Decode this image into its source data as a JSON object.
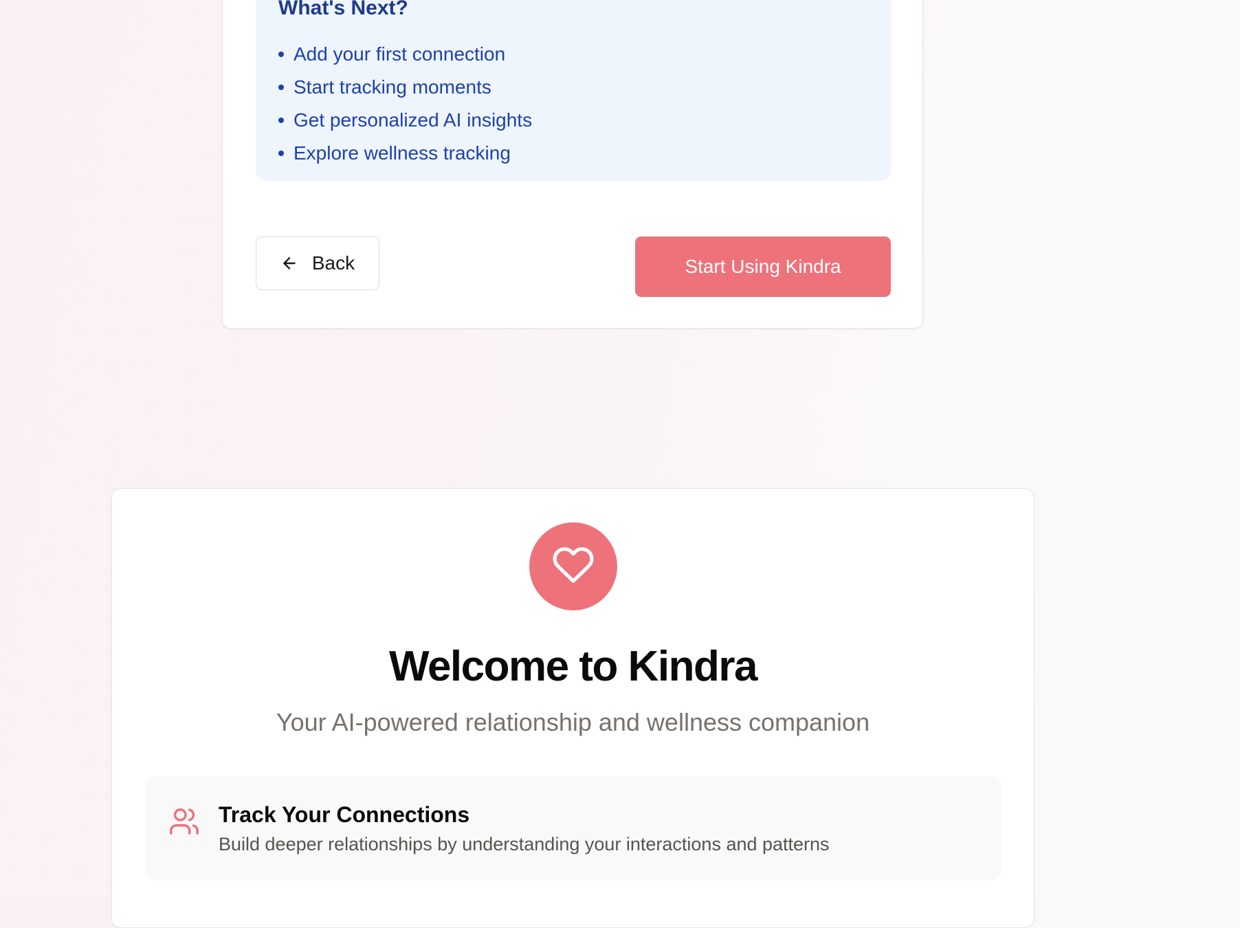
{
  "completion_card": {
    "next_title": "What's Next?",
    "next_items": [
      "Add your first connection",
      "Start tracking moments",
      "Get personalized AI insights",
      "Explore wellness tracking"
    ],
    "back_label": "Back",
    "start_label": "Start Using Kindra"
  },
  "welcome_card": {
    "title": "Welcome to Kindra",
    "subtitle": "Your AI-powered relationship and wellness companion",
    "features": [
      {
        "icon": "users-icon",
        "title": "Track Your Connections",
        "description": "Build deeper relationships by understanding your interactions and patterns"
      }
    ]
  },
  "colors": {
    "accent": "#ee727a",
    "next_box_bg": "#eef5fd",
    "next_title": "#1e3a8a",
    "next_text": "#1e40af"
  },
  "icons": [
    "arrow-left-icon",
    "heart-icon",
    "users-icon"
  ]
}
